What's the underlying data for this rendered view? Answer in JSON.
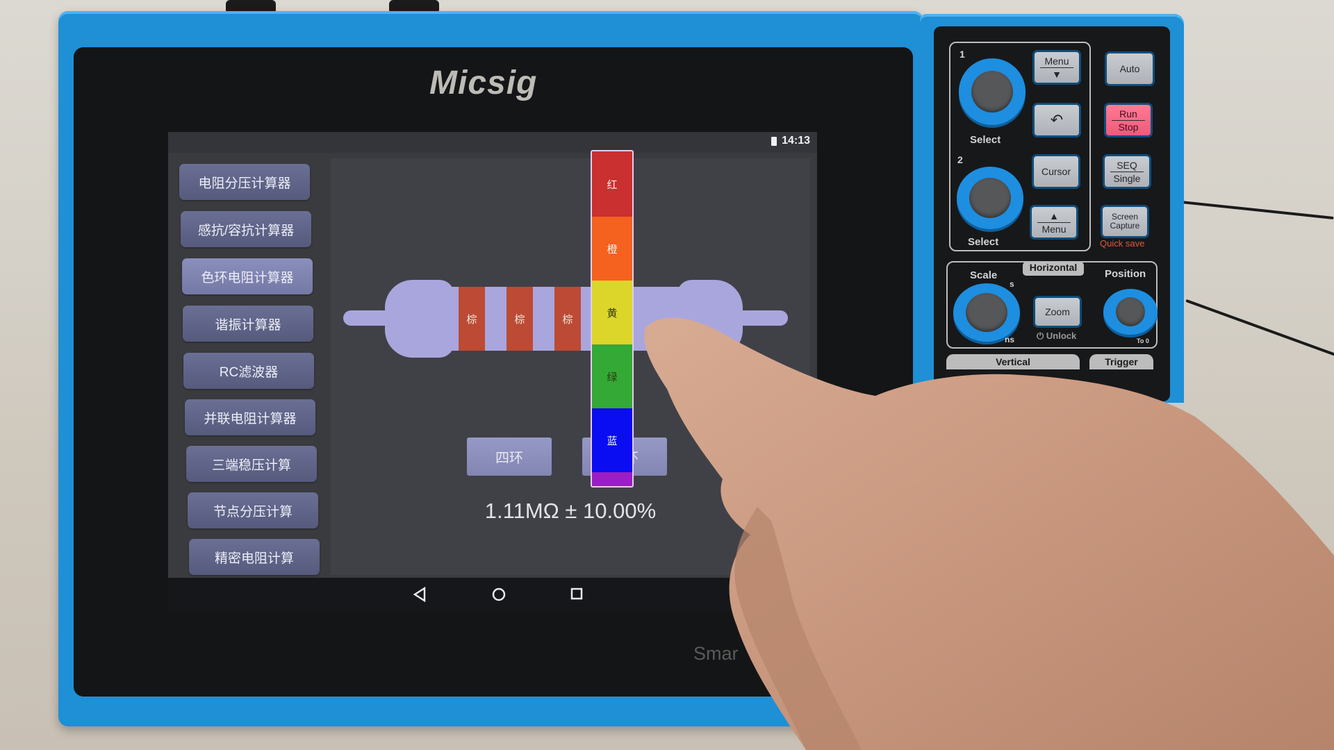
{
  "device": {
    "brand": "Micsig",
    "model_partial": "Smar",
    "bezel_color": "#1f8fd6"
  },
  "status_bar": {
    "battery_icon": "battery-icon",
    "time": "14:13"
  },
  "sidebar": {
    "items": [
      {
        "label": "电阻分压计算器",
        "active": false
      },
      {
        "label": "感抗/容抗计算器",
        "active": false
      },
      {
        "label": "色环电阻计算器",
        "active": true
      },
      {
        "label": "谐振计算器",
        "active": false
      },
      {
        "label": "RC滤波器",
        "active": false
      },
      {
        "label": "并联电阻计算器",
        "active": false
      },
      {
        "label": "三端稳压计算",
        "active": false
      },
      {
        "label": "节点分压计算",
        "active": false
      },
      {
        "label": "精密电阻计算",
        "active": false
      }
    ]
  },
  "resistor": {
    "bands": [
      {
        "label": "棕",
        "color": "#bc4a34"
      },
      {
        "label": "棕",
        "color": "#bc4a34"
      },
      {
        "label": "棕",
        "color": "#bc4a34"
      }
    ],
    "color_picker": {
      "options": [
        {
          "label": "红",
          "color": "#c9302f"
        },
        {
          "label": "橙",
          "color": "#f5611f"
        },
        {
          "label": "黄",
          "color": "#dcd62a"
        },
        {
          "label": "绿",
          "color": "#34a935"
        },
        {
          "label": "蓝",
          "color": "#0a0cf2"
        },
        {
          "label": "",
          "color": "#9b1ec4"
        }
      ]
    },
    "ring_modes": {
      "four": "四环",
      "five": "五环"
    },
    "result": "1.11MΩ ± 10.00%"
  },
  "nav_bar": {
    "back": "back-icon",
    "home": "home-icon",
    "recents": "recents-icon"
  },
  "controls": {
    "knob1_number": "1",
    "knob2_number": "2",
    "select_label": "Select",
    "menu_down": "Menu",
    "menu_up": "Menu",
    "cursor": "Cursor",
    "auto": "Auto",
    "run": "Run",
    "stop": "Stop",
    "seq": "SEQ",
    "single": "Single",
    "screen": "Screen",
    "capture": "Capture",
    "quick_save": "Quick save",
    "horizontal": "Horizontal",
    "scale": "Scale",
    "position": "Position",
    "zoom": "Zoom",
    "unlock": "Unlock",
    "s": "s",
    "ns": "ns",
    "to0": "To 0",
    "vertical": "Vertical",
    "trigger": "Trigger"
  }
}
